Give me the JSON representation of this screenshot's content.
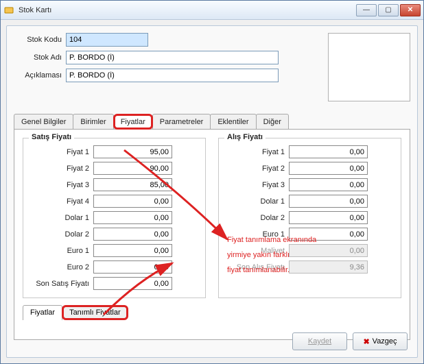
{
  "window": {
    "title": "Stok Kartı"
  },
  "fields": {
    "stok_kodu_label": "Stok Kodu",
    "stok_kodu": "104",
    "stok_adi_label": "Stok Adı",
    "stok_adi": "P. BORDO (İ)",
    "aciklama_label": "Açıklaması",
    "aciklama": "P. BORDO (İ)"
  },
  "tabs": {
    "genel": "Genel Bilgiler",
    "birimler": "Birimler",
    "fiyatlar": "Fiyatlar",
    "parametreler": "Parametreler",
    "eklentiler": "Eklentiler",
    "diger": "Diğer"
  },
  "satis": {
    "legend": "Satış Fiyatı",
    "rows": [
      {
        "label": "Fiyat 1",
        "value": "95,00"
      },
      {
        "label": "Fiyat 2",
        "value": "90,00"
      },
      {
        "label": "Fiyat 3",
        "value": "85,00"
      },
      {
        "label": "Fiyat 4",
        "value": "0,00"
      },
      {
        "label": "Dolar 1",
        "value": "0,00"
      },
      {
        "label": "Dolar 2",
        "value": "0,00"
      },
      {
        "label": "Euro 1",
        "value": "0,00"
      },
      {
        "label": "Euro 2",
        "value": "0,00"
      },
      {
        "label": "Son Satış Fiyatı",
        "value": "0,00"
      }
    ]
  },
  "alis": {
    "legend": "Alış Fiyatı",
    "rows": [
      {
        "label": "Fiyat 1",
        "value": "0,00"
      },
      {
        "label": "Fiyat 2",
        "value": "0,00"
      },
      {
        "label": "Fiyat 3",
        "value": "0,00"
      },
      {
        "label": "Dolar 1",
        "value": "0,00"
      },
      {
        "label": "Dolar 2",
        "value": "0,00"
      },
      {
        "label": "Euro 1",
        "value": "0,00"
      },
      {
        "label": "Maliyet",
        "value": "0,00",
        "disabled": true
      },
      {
        "label": "Son Alış Fiyatı",
        "value": "9,36",
        "disabled": true
      }
    ]
  },
  "subtabs": {
    "fiyatlar": "Fiyatlar",
    "tanimli": "Tanımlı Fiyatlar"
  },
  "buttons": {
    "kaydet": "Kaydet",
    "vazgec": "Vazgeç"
  },
  "annotation": {
    "line1": "Fiyat tanımlama ekranında",
    "line2": "yirmiye yakın farklı",
    "line3": "fiyat tanımlanabilir."
  }
}
